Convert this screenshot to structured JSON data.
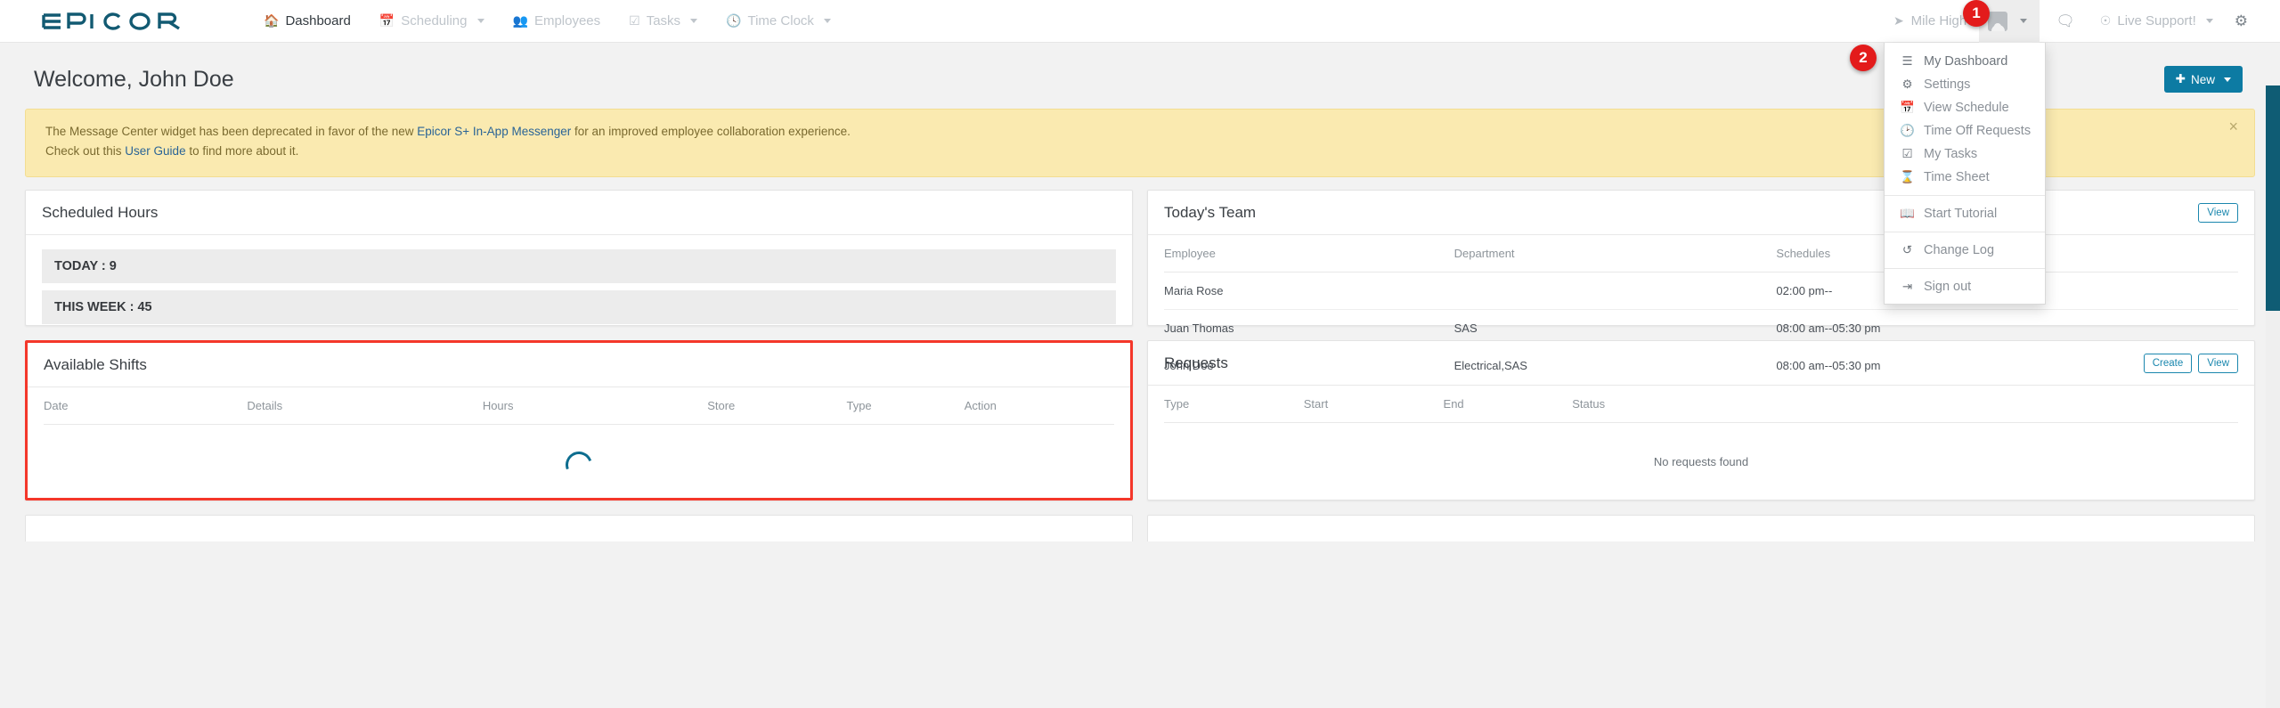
{
  "brand": {
    "name": "EPICOR"
  },
  "nav": {
    "items": [
      {
        "label": "Dashboard",
        "icon": "home-icon",
        "active": true,
        "caret": false
      },
      {
        "label": "Scheduling",
        "icon": "calendar-icon",
        "active": false,
        "caret": true
      },
      {
        "label": "Employees",
        "icon": "users-icon",
        "active": false,
        "caret": false
      },
      {
        "label": "Tasks",
        "icon": "check-square-icon",
        "active": false,
        "caret": true
      },
      {
        "label": "Time Clock",
        "icon": "clock-icon",
        "active": false,
        "caret": true
      }
    ],
    "location": "Mile High",
    "support": "Live Support!"
  },
  "user_menu": {
    "items": [
      {
        "label": "My Dashboard",
        "icon": "list-icon"
      },
      {
        "label": "Settings",
        "icon": "gears-icon"
      },
      {
        "label": "View Schedule",
        "icon": "calendar-icon"
      },
      {
        "label": "Time Off Requests",
        "icon": "clock-icon"
      },
      {
        "label": "My Tasks",
        "icon": "check-square-icon"
      },
      {
        "label": "Time Sheet",
        "icon": "hourglass-icon"
      },
      {
        "label": "Start Tutorial",
        "icon": "book-icon"
      },
      {
        "label": "Change Log",
        "icon": "history-icon"
      },
      {
        "label": "Sign out",
        "icon": "sign-out-icon"
      }
    ]
  },
  "header": {
    "welcome": "Welcome, John Doe",
    "new_button": "New"
  },
  "alert": {
    "line1_a": "The Message Center widget has been deprecated in favor of the new ",
    "link1": "Epicor S+ In-App Messenger",
    "line1_b": " for an improved employee collaboration experience.",
    "line2_a": "Check out this ",
    "link2": "User Guide",
    "line2_b": " to find more about it.",
    "close": "×"
  },
  "scheduled_hours": {
    "title": "Scheduled Hours",
    "rows": [
      "TODAY : 9",
      "THIS WEEK : 45"
    ]
  },
  "todays_team": {
    "title": "Today's Team",
    "view_button": "View",
    "columns": [
      "Employee",
      "Department",
      "Schedules"
    ],
    "rows": [
      {
        "employee": "Maria Rose",
        "department": "",
        "schedule": "02:00 pm--"
      },
      {
        "employee": "Juan Thomas",
        "department": "SAS",
        "schedule": "08:00 am--05:30 pm"
      },
      {
        "employee": "John Doe",
        "department": "Electrical,SAS",
        "schedule": "08:00 am--05:30 pm"
      }
    ]
  },
  "available_shifts": {
    "title": "Available Shifts",
    "columns": [
      "Date",
      "Details",
      "Hours",
      "Store",
      "Type",
      "Action"
    ],
    "loading": true
  },
  "requests": {
    "title": "Requests",
    "create_button": "Create",
    "view_button": "View",
    "columns": [
      "Type",
      "Start",
      "End",
      "Status"
    ],
    "empty_text": "No requests found"
  },
  "callouts": [
    {
      "number": "1"
    },
    {
      "number": "2"
    }
  ],
  "colors": {
    "accent": "#0d7ba3",
    "alert_bg": "#faeab0",
    "highlight": "#f4372a",
    "scrollbar": "#0f5c74"
  }
}
